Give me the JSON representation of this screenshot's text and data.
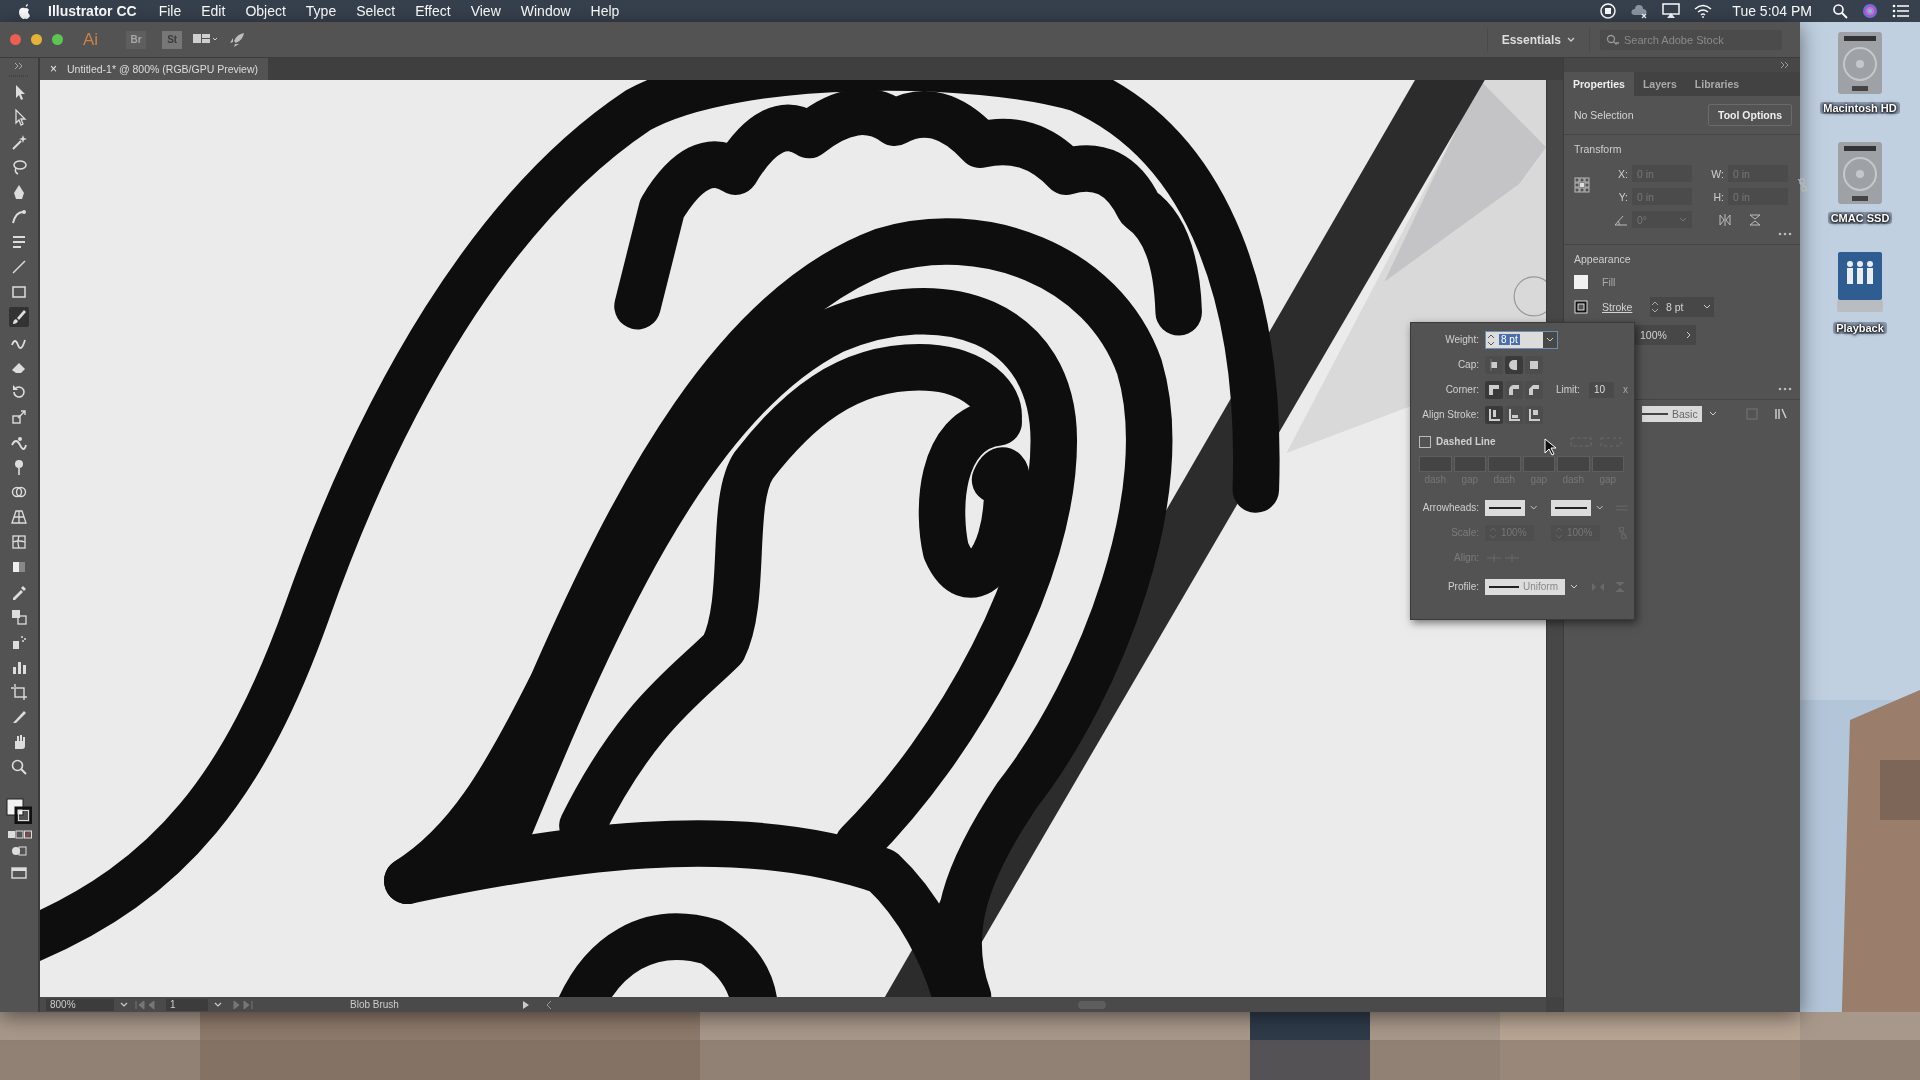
{
  "menu_bar": {
    "app_name": "Illustrator CC",
    "menus": [
      "File",
      "Edit",
      "Object",
      "Type",
      "Select",
      "Effect",
      "View",
      "Window",
      "Help"
    ],
    "clock": "Tue 5:04 PM"
  },
  "app_bar": {
    "logo": "Ai",
    "bridge": "Br",
    "stock": "St",
    "workspace": "Essentials",
    "search": {
      "placeholder": "Search Adobe Stock"
    }
  },
  "document_tab": {
    "close": "×",
    "title": "Untitled-1* @ 800% (RGB/GPU Preview)"
  },
  "tools": [
    {
      "selected": false
    },
    {
      "selected": false
    },
    {
      "selected": false
    },
    {
      "selected": false
    },
    {
      "selected": false
    },
    {
      "selected": false
    },
    {
      "selected": false
    },
    {
      "selected": false
    },
    {
      "selected": false
    },
    {
      "selected": true
    },
    {
      "selected": false
    },
    {
      "selected": false
    },
    {
      "selected": false
    },
    {
      "selected": false
    },
    {
      "selected": false
    },
    {
      "selected": false
    },
    {
      "selected": false
    },
    {
      "selected": false
    },
    {
      "selected": false
    },
    {
      "selected": false
    },
    {
      "selected": false
    },
    {
      "selected": false
    },
    {
      "selected": false
    },
    {
      "selected": false
    },
    {
      "selected": false
    },
    {
      "selected": false
    },
    {
      "selected": false
    },
    {
      "selected": false
    }
  ],
  "status_bar": {
    "zoom": "800%",
    "artboard": "1",
    "tool": "Blob Brush"
  },
  "panel": {
    "tabs": [
      {
        "label": "Properties",
        "selected": true
      },
      {
        "label": "Layers",
        "selected": false
      },
      {
        "label": "Libraries",
        "selected": false
      }
    ],
    "selection": "No Selection",
    "tool_options": "Tool Options",
    "transform": {
      "title": "Transform",
      "fields": [
        {
          "label": "X:",
          "value": "0 in"
        },
        {
          "label": "W:",
          "value": "0 in"
        },
        {
          "label": "Y:",
          "value": "0 in"
        },
        {
          "label": "H:",
          "value": "0 in"
        }
      ],
      "angle": "0°"
    },
    "appearance": {
      "title": "Appearance",
      "fill": "Fill",
      "stroke": "Stroke",
      "stroke_weight": "8 pt",
      "opacity": "100%"
    },
    "brush": "Basic"
  },
  "stroke_popup": {
    "weight_label": "Weight:",
    "weight": "8 pt",
    "cap_label": "Cap:",
    "cap": [
      {
        "selected": false
      },
      {
        "selected": true
      },
      {
        "selected": false
      }
    ],
    "corner_label": "Corner:",
    "corner": [
      {
        "selected": true
      },
      {
        "selected": false
      },
      {
        "selected": false
      }
    ],
    "limit_label": "Limit:",
    "limit": "10",
    "limit_unit": "x",
    "align_label": "Align Stroke:",
    "align": [
      {
        "selected": true
      },
      {
        "selected": false
      },
      {
        "selected": false
      }
    ],
    "dashed": {
      "label": "Dashed Line",
      "checked": false
    },
    "dash_fields": [
      "dash",
      "gap",
      "dash",
      "gap",
      "dash",
      "gap"
    ],
    "arrowheads_label": "Arrowheads:",
    "scale_label": "Scale:",
    "scale": [
      "100%",
      "100%"
    ],
    "arrow_align_label": "Align:",
    "profile_label": "Profile:",
    "profile": "Uniform"
  },
  "desktop_icons": [
    {
      "label": "Macintosh HD",
      "kind": "drive"
    },
    {
      "label": "CMAC SSD",
      "kind": "drive"
    },
    {
      "label": "Playback",
      "kind": "network"
    }
  ]
}
